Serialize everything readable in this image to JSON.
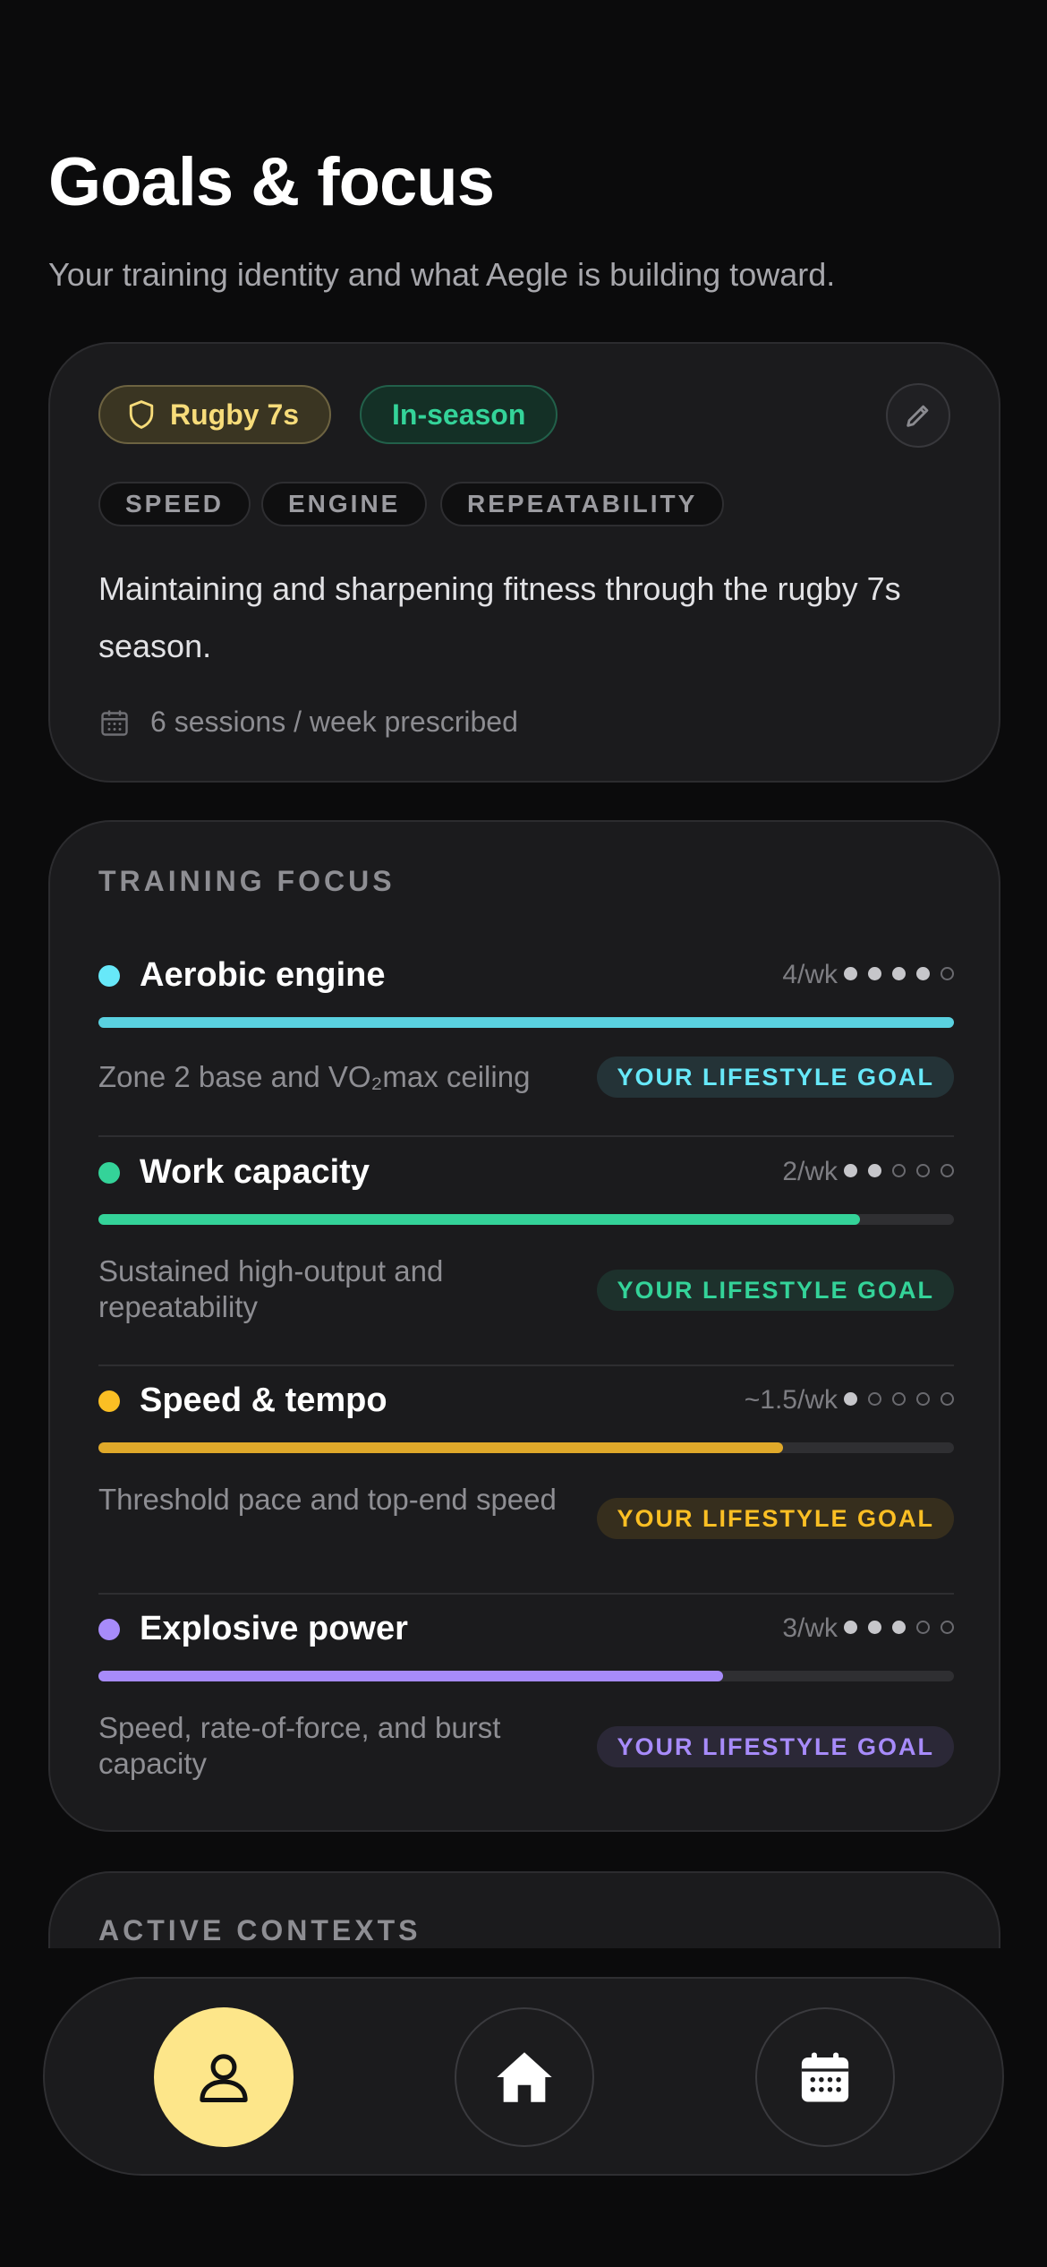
{
  "header": {
    "title": "Goals & focus",
    "subtitle": "Your training identity and what Aegle is building toward."
  },
  "identity": {
    "sport": "Rugby 7s",
    "phase": "In-season",
    "tags": [
      "SPEED",
      "ENGINE",
      "REPEATABILITY"
    ],
    "description": "Maintaining and sharpening fitness through the rugby 7s season.",
    "sessions": "6 sessions / week prescribed"
  },
  "focus": {
    "section_label": "TRAINING FOCUS",
    "items": [
      {
        "name": "Aerobic engine",
        "frequency": "4/wk",
        "level": 4,
        "progress": 1.0,
        "color": "#5ad1e0",
        "dot_color": "#67e8f9",
        "description": "Zone 2 base and VO₂max ceiling",
        "badge": "YOUR LIFESTYLE GOAL",
        "badge_color": "#67e8f9"
      },
      {
        "name": "Work capacity",
        "frequency": "2/wk",
        "level": 2,
        "progress": 0.89,
        "color": "#34d399",
        "dot_color": "#34d399",
        "description": "Sustained high-output and repeatability",
        "badge": "YOUR LIFESTYLE GOAL",
        "badge_color": "#34d399"
      },
      {
        "name": "Speed & tempo",
        "frequency": "~1.5/wk",
        "level": 1.5,
        "progress": 0.8,
        "color": "#e0a92a",
        "dot_color": "#fbbf24",
        "description": "Threshold pace and top-end speed",
        "badge": "YOUR LIFESTYLE GOAL",
        "badge_color": "#fbbf24"
      },
      {
        "name": "Explosive power",
        "frequency": "3/wk",
        "level": 3,
        "progress": 0.73,
        "color": "#a78bfa",
        "dot_color": "#a78bfa",
        "description": "Speed, rate-of-force, and burst capacity",
        "badge": "YOUR LIFESTYLE GOAL",
        "badge_color": "#a78bfa"
      }
    ]
  },
  "contexts": {
    "section_label": "ACTIVE CONTEXTS"
  },
  "nav": {
    "items": [
      {
        "icon": "person-icon",
        "active": true
      },
      {
        "icon": "home-icon",
        "active": false
      },
      {
        "icon": "calendar-icon",
        "active": false
      }
    ],
    "active_color": "#fde68a"
  }
}
